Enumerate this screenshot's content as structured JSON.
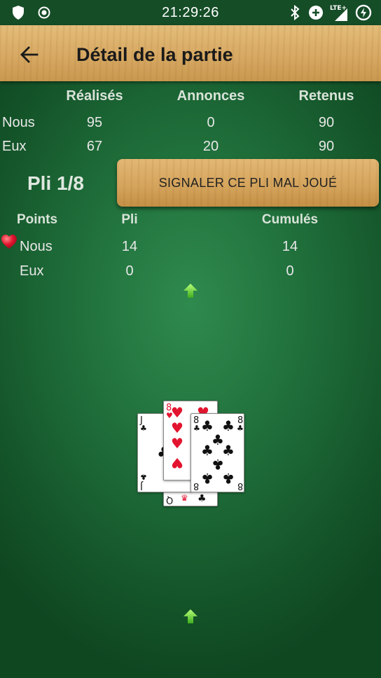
{
  "status_bar": {
    "time": "21:29:26",
    "network": "LTE+"
  },
  "app_bar": {
    "title": "Détail de la partie"
  },
  "score_table": {
    "headers": [
      "Réalisés",
      "Annonces",
      "Retenus"
    ],
    "rows": [
      {
        "label": "Nous",
        "values": [
          "95",
          "0",
          "90"
        ]
      },
      {
        "label": "Eux",
        "values": [
          "67",
          "20",
          "90"
        ]
      }
    ]
  },
  "trick": {
    "label": "Pli 1/8",
    "report_button": "SIGNALER CE PLI MAL JOUÉ"
  },
  "points_table": {
    "headers": [
      "Points",
      "Pli",
      "Cumulés"
    ],
    "rows": [
      {
        "label": "Nous",
        "values": [
          "14",
          "14"
        ],
        "trump_marker": "heart"
      },
      {
        "label": "Eux",
        "values": [
          "0",
          "0"
        ]
      }
    ]
  },
  "cards": [
    {
      "rank": "8",
      "suit": "hearts"
    },
    {
      "rank": "8",
      "suit": "clubs"
    },
    {
      "rank": "J",
      "suit": "clubs"
    },
    {
      "rank": "Q",
      "suit": "clubs"
    }
  ],
  "colors": {
    "felt": "#1f6e3a",
    "wood": "#d7a963",
    "arrow": "#5fd63a",
    "heart": "#e3142f"
  }
}
